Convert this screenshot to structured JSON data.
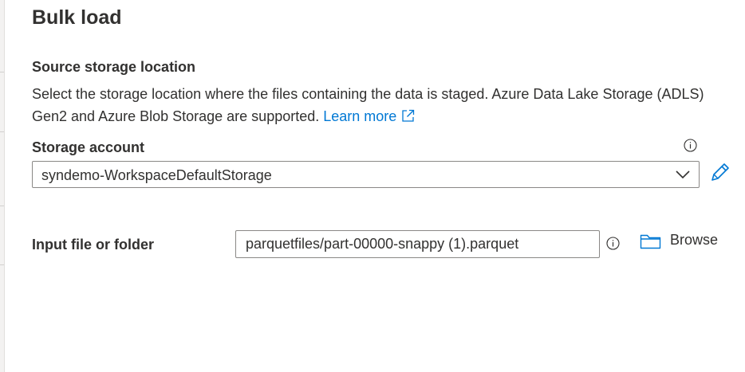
{
  "panel": {
    "title": "Bulk load"
  },
  "source": {
    "section_title": "Source storage location",
    "description": "Select the storage location where the files containing the data is staged. Azure Data Lake Storage (ADLS) Gen2 and Azure Blob Storage are supported.",
    "learn_more": "Learn more"
  },
  "storage_account": {
    "label": "Storage account",
    "selected": "syndemo-WorkspaceDefaultStorage"
  },
  "input_file": {
    "label": "Input file or folder",
    "value": "parquetfiles/part-00000-snappy (1).parquet",
    "browse_label": "Browse"
  },
  "colors": {
    "link": "#0078d4",
    "text": "#323130",
    "border": "#8a8886"
  },
  "icons": [
    "info-icon",
    "chevron-down-icon",
    "edit-icon",
    "external-link-icon",
    "folder-icon"
  ]
}
